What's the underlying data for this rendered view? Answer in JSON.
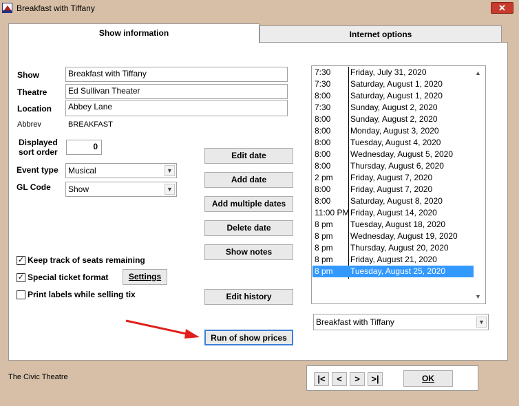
{
  "window": {
    "title": "Breakfast with Tiffany",
    "close_label": "✕"
  },
  "tabs": [
    {
      "label": "Show information",
      "active": true
    },
    {
      "label": "Internet options",
      "active": false
    }
  ],
  "form": {
    "show_label": "Show",
    "show_value": "Breakfast with Tiffany",
    "theatre_label": "Theatre",
    "theatre_value": "Ed Sullivan Theater",
    "location_label": "Location",
    "location_value": "Abbey Lane",
    "abbrev_label": "Abbrev",
    "abbrev_value": "BREAKFAST",
    "sort_label_1": "Displayed",
    "sort_label_2": "sort order",
    "sort_value": "0",
    "event_type_label": "Event type",
    "event_type_value": "Musical",
    "gl_code_label": "GL Code",
    "gl_code_value": "Show"
  },
  "buttons": {
    "edit_date": "Edit date",
    "add_date": "Add date",
    "add_multiple_dates": "Add multiple dates",
    "delete_date": "Delete date",
    "show_notes": "Show notes",
    "edit_history": "Edit history",
    "run_of_show_prices": "Run of show prices",
    "settings": "Settings"
  },
  "checkboxes": [
    {
      "label": "Keep track of seats remaining",
      "checked": true
    },
    {
      "label": "Special ticket format",
      "checked": true
    },
    {
      "label": "Print labels while selling tix",
      "checked": false
    }
  ],
  "dates": [
    {
      "time": "7:30",
      "date": "Friday, July 31, 2020"
    },
    {
      "time": "7:30",
      "date": "Saturday, August 1, 2020"
    },
    {
      "time": "8:00",
      "date": "Saturday, August 1, 2020"
    },
    {
      "time": "7:30",
      "date": "Sunday, August 2, 2020"
    },
    {
      "time": "8:00",
      "date": "Sunday, August 2, 2020"
    },
    {
      "time": "8:00",
      "date": "Monday, August 3, 2020"
    },
    {
      "time": "8:00",
      "date": "Tuesday, August 4, 2020"
    },
    {
      "time": "8:00",
      "date": "Wednesday, August 5, 2020"
    },
    {
      "time": "8:00",
      "date": "Thursday, August 6, 2020"
    },
    {
      "time": "2 pm",
      "date": "Friday, August 7, 2020"
    },
    {
      "time": "8:00",
      "date": "Friday, August 7, 2020"
    },
    {
      "time": "8:00",
      "date": "Saturday, August 8, 2020"
    },
    {
      "time": "11:00 PM",
      "date": "Friday, August 14, 2020"
    },
    {
      "time": "8 pm",
      "date": "Tuesday, August 18, 2020"
    },
    {
      "time": "8 pm",
      "date": "Wednesday, August 19, 2020"
    },
    {
      "time": "8 pm",
      "date": "Thursday, August 20, 2020"
    },
    {
      "time": "8 pm",
      "date": "Friday, August 21, 2020"
    },
    {
      "time": "8 pm",
      "date": "Tuesday, August 25, 2020",
      "selected": true
    }
  ],
  "show_select_value": "Breakfast with Tiffany",
  "footer": {
    "theatre_name": "The Civic Theatre"
  },
  "nav": {
    "first": "|<",
    "prev": "<",
    "next": ">",
    "last": ">|",
    "ok": "OK"
  },
  "colors": {
    "window_bg": "#d6bfa6",
    "selection": "#3399ff",
    "arrow": "#e0201b"
  },
  "icons": [
    "app-icon",
    "close-icon",
    "chevron-down-icon",
    "checkmark-icon",
    "arrow-annotation"
  ]
}
